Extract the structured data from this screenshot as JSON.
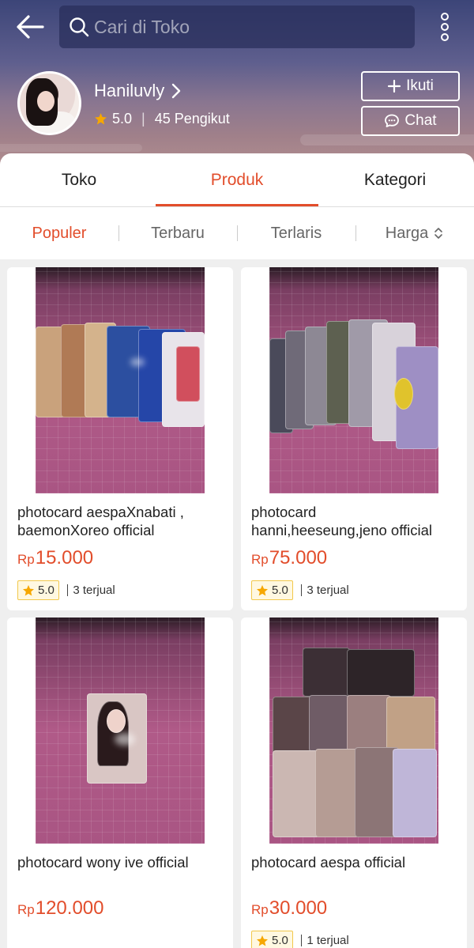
{
  "header": {
    "search_placeholder": "Cari di Toko",
    "shop_name": "Haniluvly",
    "rating": "5.0",
    "followers": "45 Pengikut",
    "follow_label": "Ikuti",
    "chat_label": "Chat"
  },
  "tabs": [
    {
      "label": "Toko"
    },
    {
      "label": "Produk",
      "active": true
    },
    {
      "label": "Kategori"
    }
  ],
  "sort": [
    {
      "label": "Populer",
      "active": true
    },
    {
      "label": "Terbaru"
    },
    {
      "label": "Terlaris"
    },
    {
      "label": "Harga"
    }
  ],
  "products": [
    {
      "title": "photocard aespaXnabati ,\nbaemonXoreo official",
      "currency": "Rp",
      "price": "15.000",
      "rating": "5.0",
      "sold": "3 terjual"
    },
    {
      "title": "photocard\nhanni,heeseung,jeno official",
      "currency": "Rp",
      "price": "75.000",
      "rating": "5.0",
      "sold": "3 terjual"
    },
    {
      "title": "photocard wony ive official",
      "currency": "Rp",
      "price": "120.000"
    },
    {
      "title": "photocard aespa official",
      "currency": "Rp",
      "price": "30.000",
      "rating": "5.0",
      "sold": "1 terjual"
    }
  ],
  "colors": {
    "accent": "#e24d2b",
    "star": "#f6a700"
  }
}
